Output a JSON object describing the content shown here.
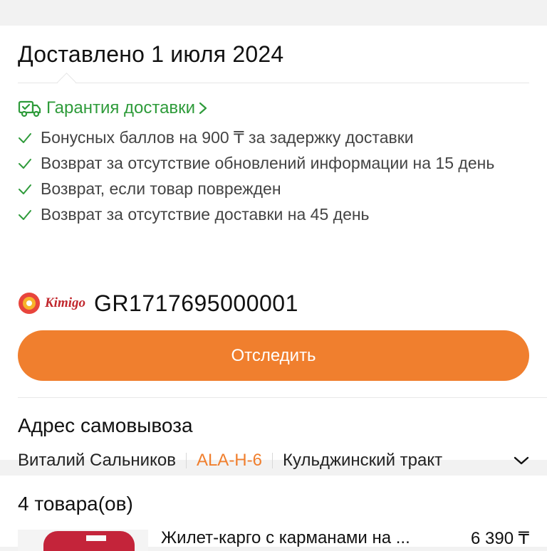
{
  "delivery": {
    "status_title": "Доставлено 1 июля 2024",
    "guarantee_label": "Гарантия доставки",
    "guarantee_items": [
      "Бонусных баллов на 900 ₸ за задержку доставки",
      "Возврат за отсутствие обновлений информации на 15 день",
      "Возврат, если товар поврежден",
      "Возврат за отсутствие доставки на 45 день"
    ],
    "carrier_name": "Kimigo",
    "tracking_number": "GR1717695000001",
    "track_button": "Отследить"
  },
  "pickup": {
    "title": "Адрес самовывоза",
    "recipient": "Виталий Сальников",
    "point_code": "ALA-H-6",
    "street": "Кульджинский тракт"
  },
  "items": {
    "count_label": "4 товара(ов)",
    "first_product_name": "Жилет-карго с карманами на ...",
    "first_product_price": "6 390 ₸"
  },
  "colors": {
    "accent_orange": "#f07f2e",
    "guarantee_green": "#2e9b3a"
  },
  "icons": [
    "delivery-truck-icon",
    "chevron-right-icon",
    "check-icon",
    "kimigo-logo",
    "chevron-down-icon"
  ]
}
